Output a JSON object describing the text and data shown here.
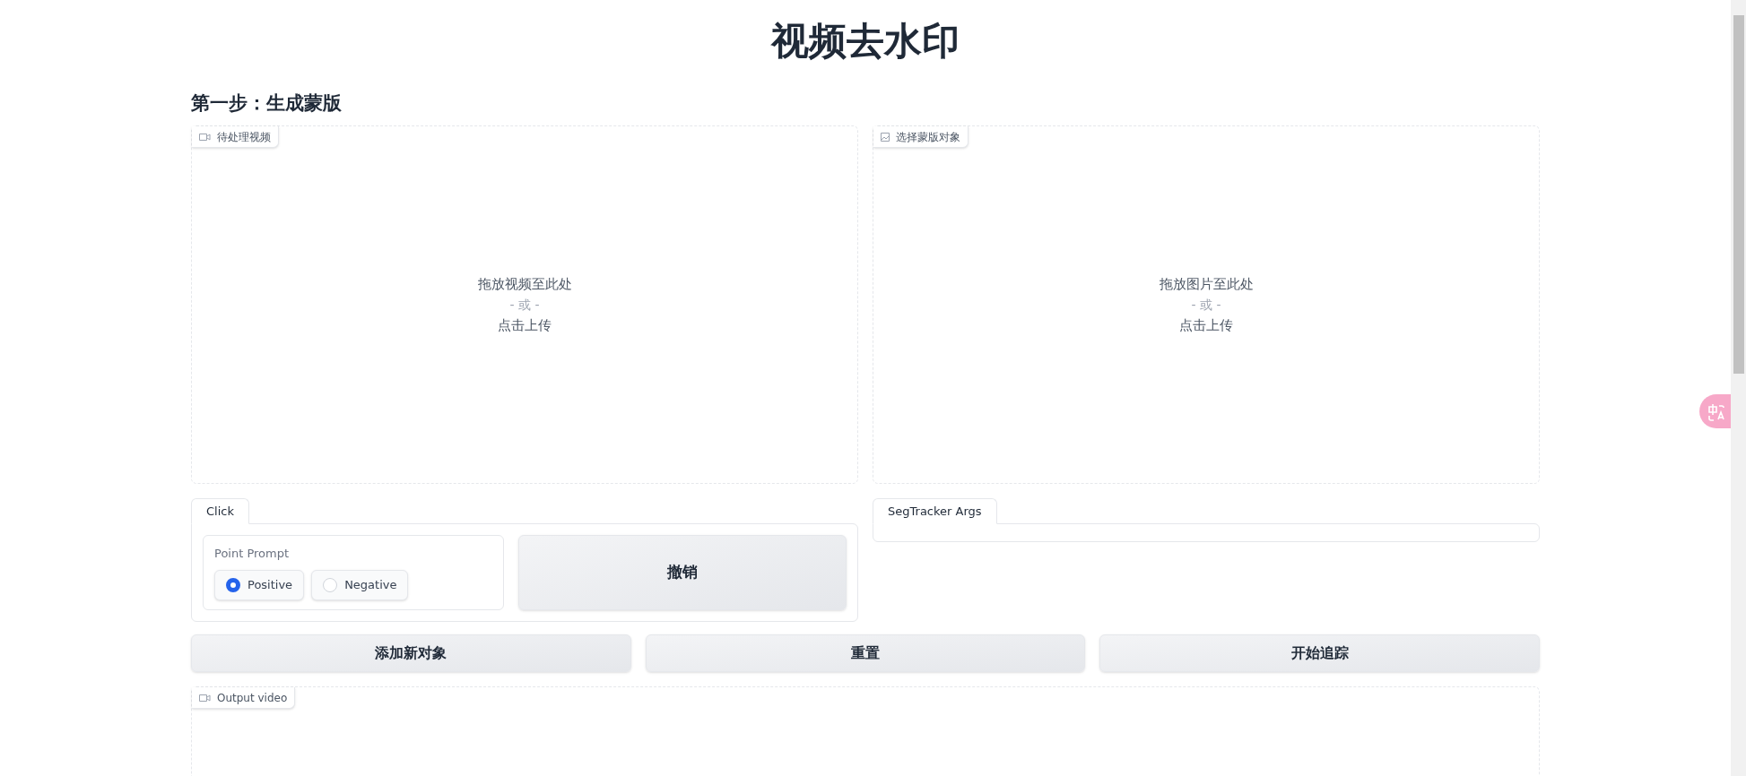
{
  "title": "视频去水印",
  "step_heading": "第一步：生成蒙版",
  "uploads": [
    {
      "kind": "video",
      "label": "待处理视频",
      "drop_text": "拖放视频至此处",
      "or_text": "- 或 -",
      "click_text": "点击上传"
    },
    {
      "kind": "image",
      "label": "选择蒙版对象",
      "drop_text": "拖放图片至此处",
      "or_text": "- 或 -",
      "click_text": "点击上传"
    }
  ],
  "left_tabs": [
    {
      "label": "Click",
      "selected": true
    }
  ],
  "point_prompt": {
    "label": "Point Prompt",
    "options": [
      {
        "label": "Positive",
        "selected": true
      },
      {
        "label": "Negative",
        "selected": false
      }
    ]
  },
  "undo_button": "撤销",
  "right_tabs": [
    {
      "label": "SegTracker Args",
      "selected": true
    }
  ],
  "action_buttons": [
    "添加新对象",
    "重置",
    "开始追踪"
  ],
  "output": {
    "kind": "video",
    "label": "Output video"
  }
}
